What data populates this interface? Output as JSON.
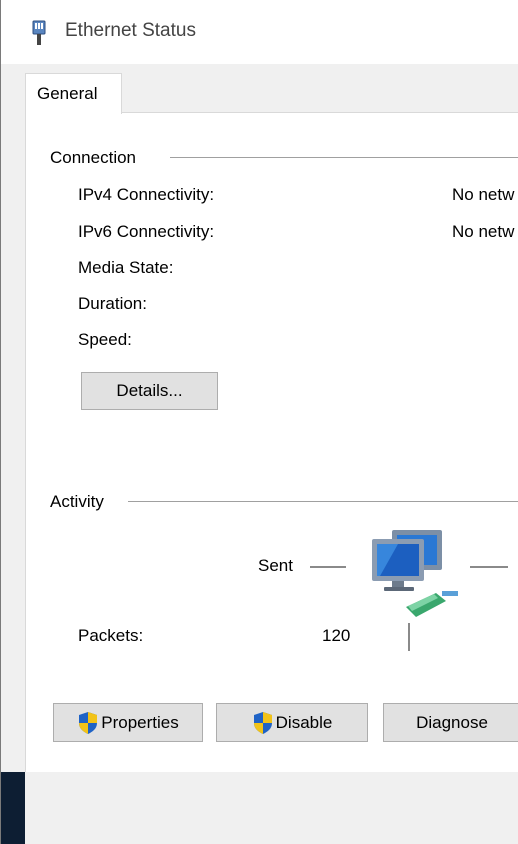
{
  "window": {
    "title": "Ethernet Status"
  },
  "tabs": [
    {
      "label": "General"
    }
  ],
  "connection": {
    "heading": "Connection",
    "rows": [
      {
        "label": "IPv4 Connectivity:",
        "value": "No netw"
      },
      {
        "label": "IPv6 Connectivity:",
        "value": "No netw"
      },
      {
        "label": "Media State:",
        "value": ""
      },
      {
        "label": "Duration:",
        "value": ""
      },
      {
        "label": "Speed:",
        "value": ""
      }
    ],
    "details_button": "Details..."
  },
  "activity": {
    "heading": "Activity",
    "sent_label": "Sent",
    "packets_label": "Packets:",
    "packets_sent": "120",
    "icon": "network-computers-icon"
  },
  "buttons": {
    "properties": "Properties",
    "disable": "Disable",
    "diagnose": "Diagnose"
  },
  "colors": {
    "shield_blue": "#1f63c6",
    "shield_yellow": "#f2c318"
  }
}
